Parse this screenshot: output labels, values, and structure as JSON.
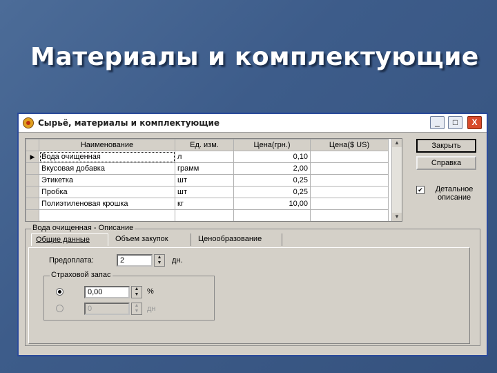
{
  "slide": {
    "title": "Материалы и комплектующие"
  },
  "window": {
    "title": "Сырьё, материалы и комплектующие",
    "controls": {
      "minimize": "_",
      "maximize": "□",
      "close": "X"
    }
  },
  "grid": {
    "columns": [
      "Наименование",
      "Ед. изм.",
      "Цена(грн.)",
      "Цена($ US)"
    ],
    "rows": [
      {
        "name": "Вода очищенная",
        "unit": "л",
        "price_uah": "0,10",
        "price_usd": ""
      },
      {
        "name": "Вкусовая добавка",
        "unit": "грамм",
        "price_uah": "2,00",
        "price_usd": ""
      },
      {
        "name": "Этикетка",
        "unit": "шт",
        "price_uah": "0,25",
        "price_usd": ""
      },
      {
        "name": "Пробка",
        "unit": "шт",
        "price_uah": "0,25",
        "price_usd": ""
      },
      {
        "name": "Полиэтиленовая крошка",
        "unit": "кг",
        "price_uah": "10,00",
        "price_usd": ""
      }
    ],
    "current_row_marker": "▶"
  },
  "buttons": {
    "close": "Закрыть",
    "help": "Справка"
  },
  "detail_checkbox": {
    "label": "Детальное описание",
    "checked": true,
    "mark": "✔"
  },
  "description": {
    "legend": "Вода очищенная - Описание",
    "tabs": [
      "Общие данные",
      "Объем закупок",
      "Ценообразование"
    ],
    "prepay_label": "Предоплата:",
    "prepay_value": "2",
    "prepay_unit": "дн.",
    "stock_legend": "Страховой запас",
    "stock_percent_value": "0,00",
    "stock_percent_unit": "%",
    "stock_days_value": "0",
    "stock_days_unit": "дн"
  }
}
